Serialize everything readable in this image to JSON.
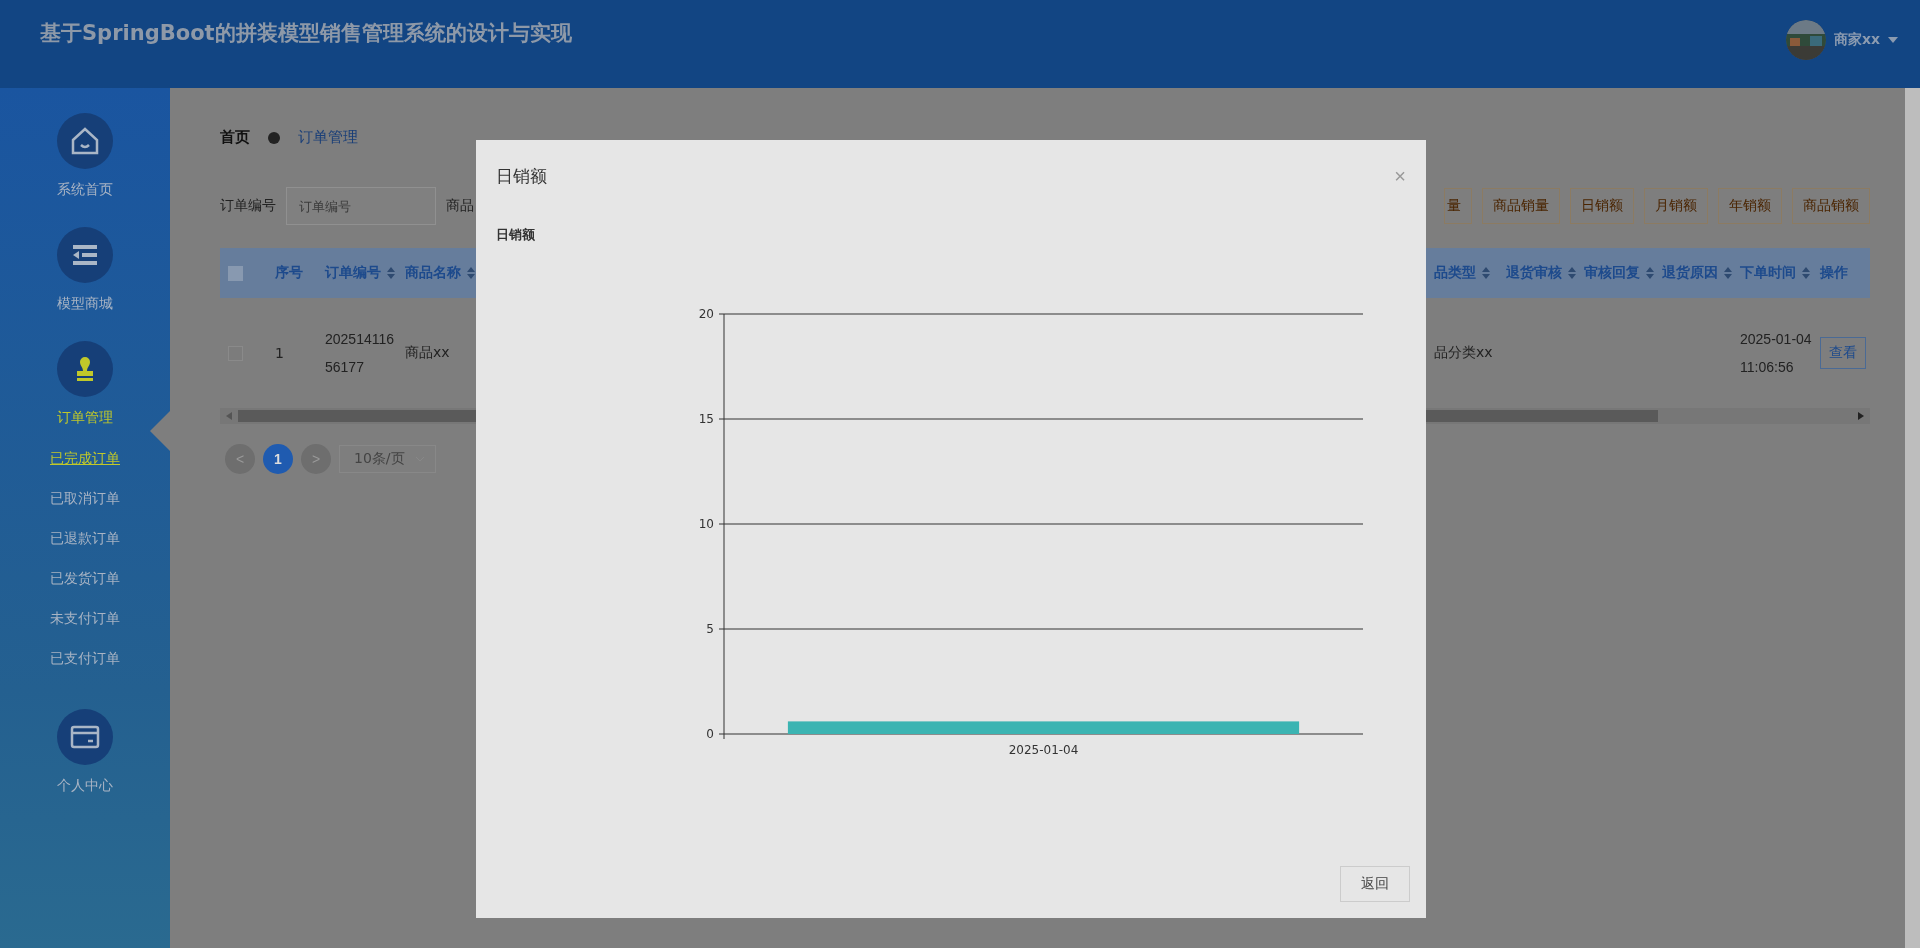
{
  "header": {
    "title": "基于SpringBoot的拼装模型销售管理系统的设计与实现",
    "user": {
      "name": "商家xx"
    }
  },
  "sidebar": {
    "items": [
      {
        "label": "系统首页",
        "kind": "home",
        "selected": false
      },
      {
        "label": "模型商城",
        "kind": "list",
        "selected": false
      },
      {
        "label": "订单管理",
        "kind": "stamp",
        "selected": true,
        "children": [
          {
            "label": "已完成订单",
            "selected": true
          },
          {
            "label": "已取消订单",
            "selected": false
          },
          {
            "label": "已退款订单",
            "selected": false
          },
          {
            "label": "已发货订单",
            "selected": false
          },
          {
            "label": "未支付订单",
            "selected": false
          },
          {
            "label": "已支付订单",
            "selected": false
          }
        ]
      },
      {
        "label": "个人中心",
        "kind": "card",
        "selected": false
      }
    ]
  },
  "breadcrumb": [
    "首页",
    "订单管理"
  ],
  "search": {
    "label": "订单编号",
    "placeholder": "订单编号",
    "next_label": "商品"
  },
  "toolbar": [
    "量",
    "商品销量",
    "日销额",
    "月销额",
    "年销额",
    "商品销额"
  ],
  "table": {
    "columns_left": [
      {
        "label": "序号",
        "sortable": false
      },
      {
        "label": "订单编号",
        "sortable": true
      },
      {
        "label": "商品名称",
        "sortable": true
      }
    ],
    "columns_right": [
      {
        "label": "品类型",
        "sortable": true
      },
      {
        "label": "退货审核",
        "sortable": true
      },
      {
        "label": "审核回复",
        "sortable": true
      },
      {
        "label": "退货原因",
        "sortable": true
      },
      {
        "label": "下单时间",
        "sortable": true
      },
      {
        "label": "操作",
        "sortable": false
      }
    ],
    "header_checked": false,
    "rows": [
      {
        "checked": false,
        "index": "1",
        "order_no": "20251411656177",
        "product": "商品xx",
        "category": "品分类xx",
        "time": "2025-01-04 11:06:56",
        "action": "查看"
      }
    ]
  },
  "pagination": {
    "prev": "<",
    "pages": [
      {
        "label": "1",
        "selected": true
      }
    ],
    "next": ">",
    "size": "10条/页"
  },
  "modal": {
    "title": "日销额",
    "close": "×",
    "button": "返回",
    "chart_data": {
      "type": "bar",
      "grid": true,
      "title": "日销额",
      "categories": [
        "2025-01-04"
      ],
      "values": [
        0.6
      ],
      "ylim": [
        0,
        20
      ],
      "yticks": [
        0,
        5,
        10,
        15,
        20
      ]
    }
  }
}
